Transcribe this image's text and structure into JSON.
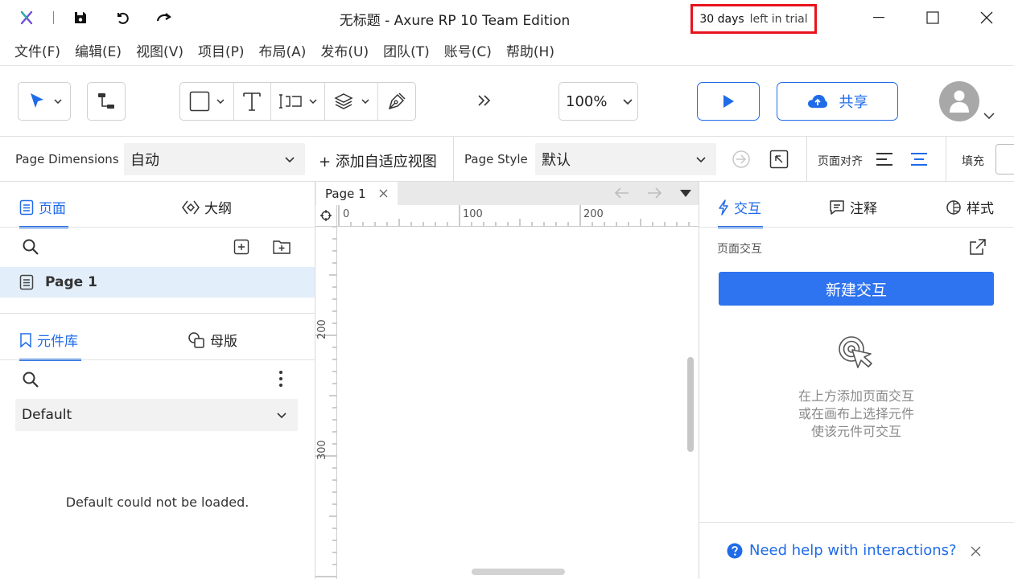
{
  "window": {
    "title": "无标题 - Axure RP 10 Team Edition",
    "trial_bold": "30 days",
    "trial_rest": "left in trial",
    "app_icon": "axure-logo-icon"
  },
  "menu": [
    "文件(F)",
    "编辑(E)",
    "视图(V)",
    "项目(P)",
    "布局(A)",
    "发布(U)",
    "团队(T)",
    "账号(C)",
    "帮助(H)"
  ],
  "toolbar": {
    "zoom": "100%",
    "share_label": "共享",
    "accent": "#1f6be8"
  },
  "pagebar": {
    "dimensions_label": "Page Dimensions",
    "dimensions_value": "自动",
    "add_view_label": "+ 添加自适应视图",
    "style_label": "Page Style",
    "style_value": "默认",
    "align_label": "页面对齐",
    "fill_label": "填充"
  },
  "left": {
    "tab_pages": "页面",
    "tab_outline": "大纲",
    "page_item": "Page 1",
    "tab_library": "元件库",
    "tab_masters": "母版",
    "library_select": "Default",
    "library_message": "Default could not be loaded."
  },
  "canvas": {
    "tab": "Page 1",
    "ruler_h": [
      "0",
      "100",
      "200"
    ],
    "ruler_v": [
      "200",
      "300"
    ]
  },
  "right": {
    "tab_interactions": "交互",
    "tab_notes": "注释",
    "tab_style": "样式",
    "section_label": "页面交互",
    "new_button": "新建交互",
    "hint_1": "在上方添加页面交互",
    "hint_2": "或在画布上选择元件",
    "hint_3": "使该元件可交互",
    "help_link": "Need help with interactions?"
  }
}
